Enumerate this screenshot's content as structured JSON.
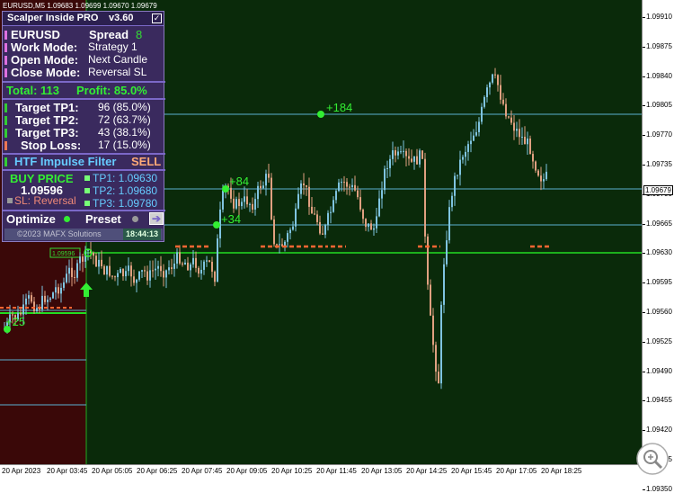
{
  "chart": {
    "symbol_title": "EURUSD,M5  1.09683 1.09699 1.09670 1.09679",
    "current_price": "1.09679",
    "price_labels": [
      "1.09910",
      "1.09875",
      "1.09840",
      "1.09805",
      "1.09770",
      "1.09735",
      "1.09700",
      "1.09665",
      "1.09630",
      "1.09595",
      "1.09560",
      "1.09525",
      "1.09490",
      "1.09455",
      "1.09420",
      "1.09385",
      "1.09350"
    ],
    "time_labels": [
      "20 Apr 2023",
      "20 Apr 03:45",
      "20 Apr 05:05",
      "20 Apr 06:25",
      "20 Apr 07:45",
      "20 Apr 09:05",
      "20 Apr 10:25",
      "20 Apr 11:45",
      "20 Apr 13:05",
      "20 Apr 14:25",
      "20 Apr 15:45",
      "20 Apr 17:05",
      "20 Apr 18:25"
    ],
    "annotations": [
      "+184",
      "+84",
      "+34",
      "+25"
    ],
    "entry_box_label": "1.09596",
    "colors": {
      "bull": "#7fc4e0",
      "bear": "#e0a080",
      "bg_main": "#0a2a0a",
      "bg_left": "#3a0808",
      "tp_line": "#5ab0d0",
      "entry_line": "#22dd22"
    }
  },
  "panel": {
    "title": "Scalper Inside PRO",
    "version": "v3.60",
    "checkbox": "✓",
    "symbol": "EURUSD",
    "spread_label": "Spread",
    "spread_value": "8",
    "rows": [
      {
        "label": "Work  Mode:",
        "value": "Strategy 1"
      },
      {
        "label": "Open  Mode:",
        "value": "Next Candle"
      },
      {
        "label": "Close Mode:",
        "value": "Reversal SL"
      }
    ],
    "total": "Total: 113",
    "profit": "Profit:  85.0%",
    "targets": [
      {
        "label": "Target TP1:",
        "value": "96 (85.0%)"
      },
      {
        "label": "Target TP2:",
        "value": "72 (63.7%)"
      },
      {
        "label": "Target TP3:",
        "value": "43 (38.1%)"
      },
      {
        "label": "Stop Loss:",
        "value": "17 (15.0%)"
      }
    ],
    "htf_label": "HTF Impulse Filter",
    "htf_value": "SELL",
    "buy_price_label": "BUY PRICE",
    "buy_price_value": "1.09596",
    "sl_label": "SL: Reversal",
    "tps": [
      "TP1: 1.09630",
      "TP2: 1.09680",
      "TP3: 1.09780"
    ],
    "optimize_label": "Optimize",
    "preset_label": "Preset",
    "arrow": "➔",
    "copyright": "©2023 MAFX Solutions",
    "clock": "18:44:13"
  }
}
